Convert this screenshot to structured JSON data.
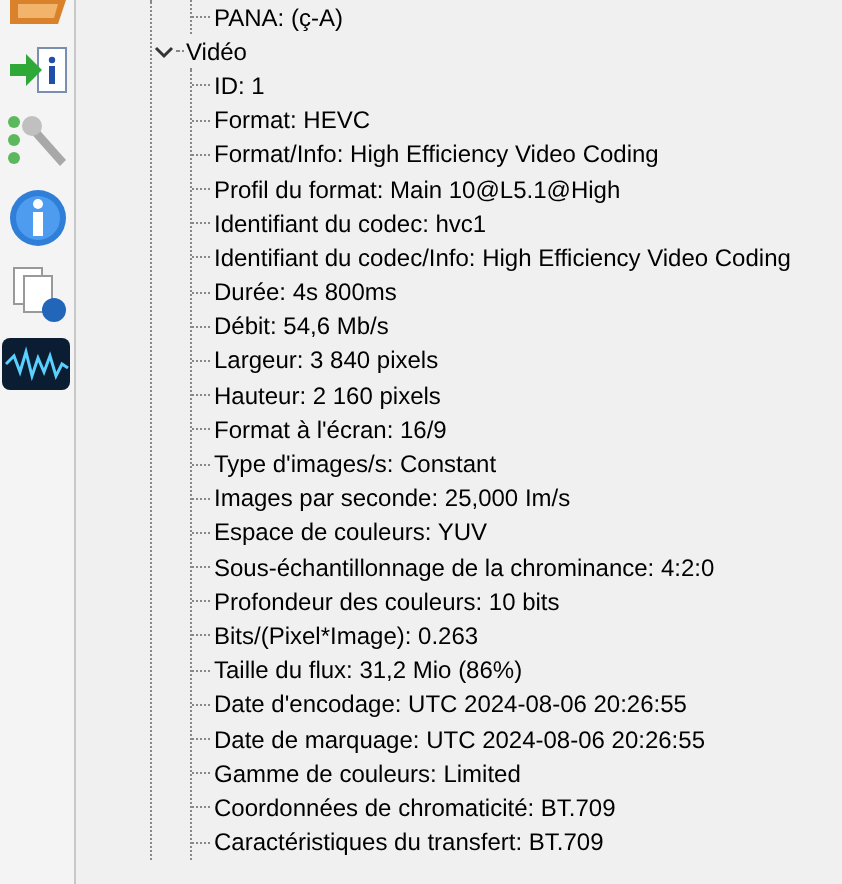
{
  "tree": [
    {
      "expanded": true,
      "children": [
        {
          "label": "PANA: (ç-A)"
        }
      ]
    },
    {
      "label": "Vidéo",
      "expanded": true,
      "children": [
        {
          "label": "ID: 1"
        },
        {
          "label": "Format: HEVC"
        },
        {
          "label": "Format/Info: High Efficiency Video Coding"
        },
        {
          "label": "Profil du format: Main 10@L5.1@High"
        },
        {
          "label": "Identifiant du codec: hvc1"
        },
        {
          "label": "Identifiant du codec/Info: High Efficiency Video Coding"
        },
        {
          "label": "Durée: 4s 800ms"
        },
        {
          "label": "Débit: 54,6 Mb/s"
        },
        {
          "label": "Largeur: 3 840 pixels"
        },
        {
          "label": "Hauteur: 2 160 pixels"
        },
        {
          "label": "Format à l'écran: 16/9"
        },
        {
          "label": "Type d'images/s: Constant"
        },
        {
          "label": "Images par seconde: 25,000 Im/s"
        },
        {
          "label": "Espace de couleurs: YUV"
        },
        {
          "label": "Sous-échantillonnage de la chrominance: 4:2:0"
        },
        {
          "label": "Profondeur des couleurs: 10 bits"
        },
        {
          "label": "Bits/(Pixel*Image): 0.263"
        },
        {
          "label": "Taille du flux: 31,2 Mio (86%)"
        },
        {
          "label": "Date d'encodage: UTC 2024-08-06 20:26:55"
        },
        {
          "label": "Date de marquage: UTC 2024-08-06 20:26:55"
        },
        {
          "label": "Gamme de couleurs: Limited"
        },
        {
          "label": "Coordonnées de chromaticité: BT.709"
        },
        {
          "label": "Caractéristiques du transfert: BT.709"
        }
      ]
    }
  ]
}
